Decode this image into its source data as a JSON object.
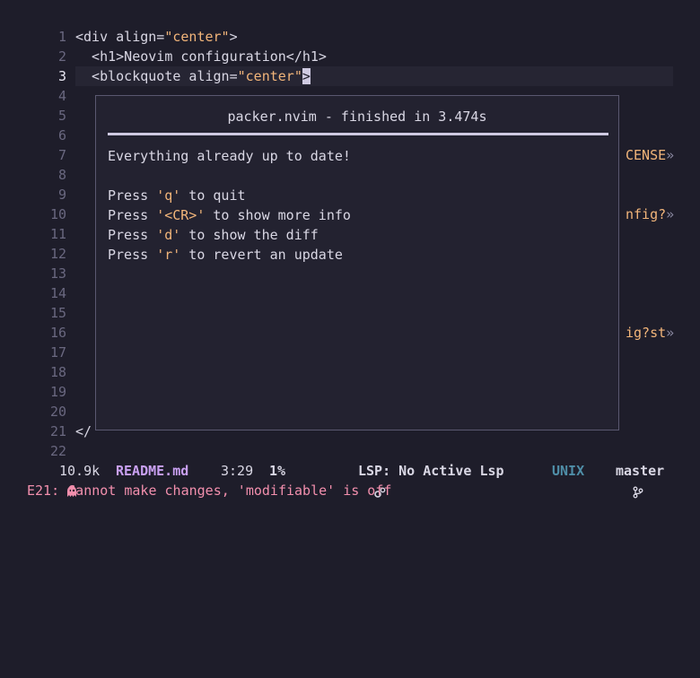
{
  "editor": {
    "line_numbers": [
      "1",
      "2",
      "3",
      "4",
      "5",
      "6",
      "7",
      "8",
      "9",
      "10",
      "11",
      "12",
      "13",
      "14",
      "15",
      "16",
      "17",
      "18",
      "19",
      "20",
      "21",
      "22"
    ],
    "line1": {
      "a": "<div align=",
      "b": "\"center\"",
      "c": ">"
    },
    "line2": {
      "a": "  <h1>Neovim configuration</h1>"
    },
    "line3": {
      "a": "  <blockquote align=",
      "b": "\"center\"",
      "cursor": ">"
    },
    "line21": {
      "a": "</"
    },
    "frag7": {
      "text": "CENSE",
      "chev": "»"
    },
    "frag10": {
      "text": "nfig?",
      "chev": "»"
    },
    "frag16": {
      "text": "ig?st",
      "chev": "»"
    }
  },
  "popup": {
    "title": "packer.nvim - finished in 3.474s",
    "status": "Everything already up to date!",
    "help": [
      {
        "pre": "Press ",
        "key": "'q'",
        "post": " to quit"
      },
      {
        "pre": "Press ",
        "key": "'<CR>'",
        "post": " to show more info"
      },
      {
        "pre": "Press ",
        "key": "'d'",
        "post": " to show the diff"
      },
      {
        "pre": "Press ",
        "key": "'r'",
        "post": " to revert an update"
      }
    ]
  },
  "statusline": {
    "mode_icon": "ghost-icon",
    "size": "10.9k",
    "filename": "README.md",
    "position": "3:29",
    "percent": "1%",
    "lsp_icon": "gears-icon",
    "lsp": "LSP: No Active Lsp",
    "format": "UNIX",
    "branch_icon": "git-branch-icon",
    "branch": "master"
  },
  "message": "E21: Cannot make changes, 'modifiable' is off",
  "colors": {
    "background": "#1e1d2a",
    "string": "#f2b57a",
    "error": "#f28fad",
    "filename": "#c9a0f2",
    "format": "#4f8ea8"
  }
}
